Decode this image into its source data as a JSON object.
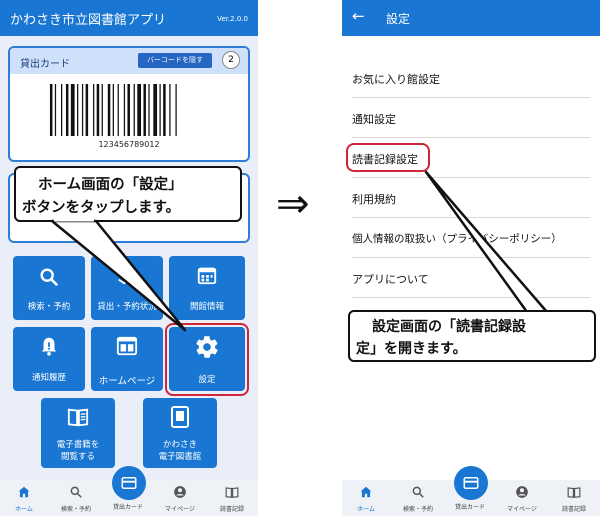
{
  "left_screen": {
    "app_title": "かわさき市立図書館アプリ",
    "version": "Ver.2.0.0",
    "card": {
      "title": "貸出カード",
      "barcode_button": "バーコードを隠す",
      "count": "2",
      "barcode_number": "123456789012"
    },
    "tiles": {
      "search": "検索・予約",
      "lending": "貸出・予約状況",
      "calendar": "開館情報",
      "notice": "通知履歴",
      "homepage": "ホームページ",
      "settings": "設定",
      "ebook_line1": "電子書籍を",
      "ebook_line2": "閲覧する",
      "archive_line1": "かわさき",
      "archive_line2": "電子図書館"
    },
    "callout_line1": "ホーム画面の「設定」",
    "callout_line2": "ボタンをタップします。",
    "nav": [
      "ホーム",
      "検索・予約",
      "貸出カード",
      "マイページ",
      "読書記録"
    ]
  },
  "arrow": "⇒",
  "right_screen": {
    "title": "設定",
    "back_icon": "←",
    "items": [
      "お気に入り館設定",
      "通知設定",
      "読書記録設定",
      "利用規約",
      "個人情報の取扱い（プライバシーポリシー）",
      "アプリについて"
    ],
    "callout_line1": "設定画面の「読書記録設",
    "callout_line2": "定」を開きます。",
    "nav": [
      "ホーム",
      "検索・予約",
      "貸出カード",
      "マイページ",
      "読書記録"
    ]
  },
  "colors": {
    "primary": "#1976d2",
    "highlight": "#d0263a",
    "background": "#e9eef8"
  }
}
